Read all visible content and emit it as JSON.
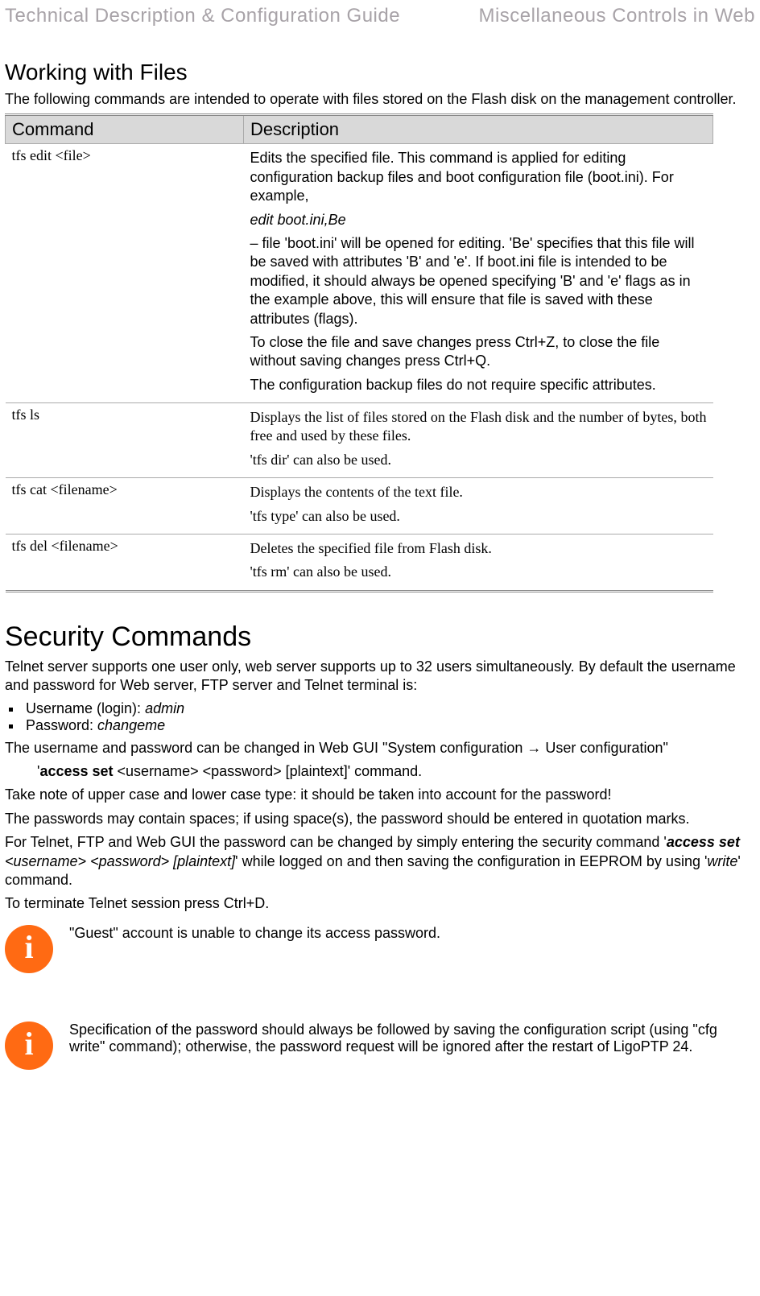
{
  "header": {
    "left": "Technical Description & Configuration Guide",
    "right": "Miscellaneous Controls in Web"
  },
  "section1": {
    "title": "Working with Files",
    "intro": "The following commands are intended to operate with files stored on the Flash disk on the management controller.",
    "table": {
      "headers": {
        "cmd": "Command",
        "desc": "Description"
      },
      "rows": [
        {
          "cmd": "tfs edit <file>",
          "desc_p1": "Edits the specified file. This command is applied for editing configuration backup files and boot configuration file (boot.ini). For example,",
          "desc_example": " edit boot.ini,Be",
          "desc_p2": "– file 'boot.ini' will be opened for editing. 'Be' specifies that this file will be saved with attributes 'B' and 'e'. If boot.ini file is intended to be modified, it should always be opened specifying 'B' and 'e' flags as in the example above, this will ensure that file is saved with these attributes (flags).",
          "desc_p3": "To close the file and save changes press Ctrl+Z, to close the file without saving changes press Ctrl+Q.",
          "desc_p4": "The configuration backup files do not require specific attributes."
        },
        {
          "cmd": "tfs ls",
          "desc_p1": "Displays the list of files stored on the Flash disk and the number of bytes, both free and used by these files.",
          "desc_p2": "'tfs dir' can also be used."
        },
        {
          "cmd": "tfs cat <filename>",
          "desc_p1": "Displays the contents of the text file.",
          "desc_p2": "'tfs type' can also be used."
        },
        {
          "cmd": "tfs del <filename>",
          "desc_p1": "Deletes the specified file from Flash disk.",
          "desc_p2": "'tfs rm' can also be used."
        }
      ]
    }
  },
  "section2": {
    "title": "Security Commands",
    "p1": "Telnet server supports one user only, web server supports up to 32 users simultaneously. By default the username and password for Web server, FTP server and Telnet terminal is:",
    "bullets": {
      "b1_label": "Username (login): ",
      "b1_value": "admin",
      "b2_label": "Password: ",
      "b2_value": "changeme"
    },
    "p2": "The username and password can be changed in Web GUI \"System configuration → User configuration\"",
    "cmd_line_prefix": "'",
    "cmd_line_bold": "access set",
    "cmd_line_rest": " <username> <password> [plaintext]' command.",
    "p3": "Take note of upper case and lower case type: it should be taken into account for the password!",
    "p4": "The passwords may contain spaces; if using space(s), the password should be entered in quotation marks.",
    "p5_pre": "For Telnet, FTP and Web GUI the password can be changed by simply entering the security command '",
    "p5_bi": "access set",
    "p5_i": " <username> <password> [plaintext]",
    "p5_mid": "' while logged on and then saving the configuration in EEPROM by using '",
    "p5_write": "write",
    "p5_post": "' command.",
    "p6": "To terminate Telnet session press Ctrl+D.",
    "note1": "\"Guest\" account is unable to change its access password.",
    "note2": "Specification of the password should always be followed by saving the configuration script (using \"cfg write\" command); otherwise, the password request will be ignored after the restart of LigoPTP 24."
  }
}
